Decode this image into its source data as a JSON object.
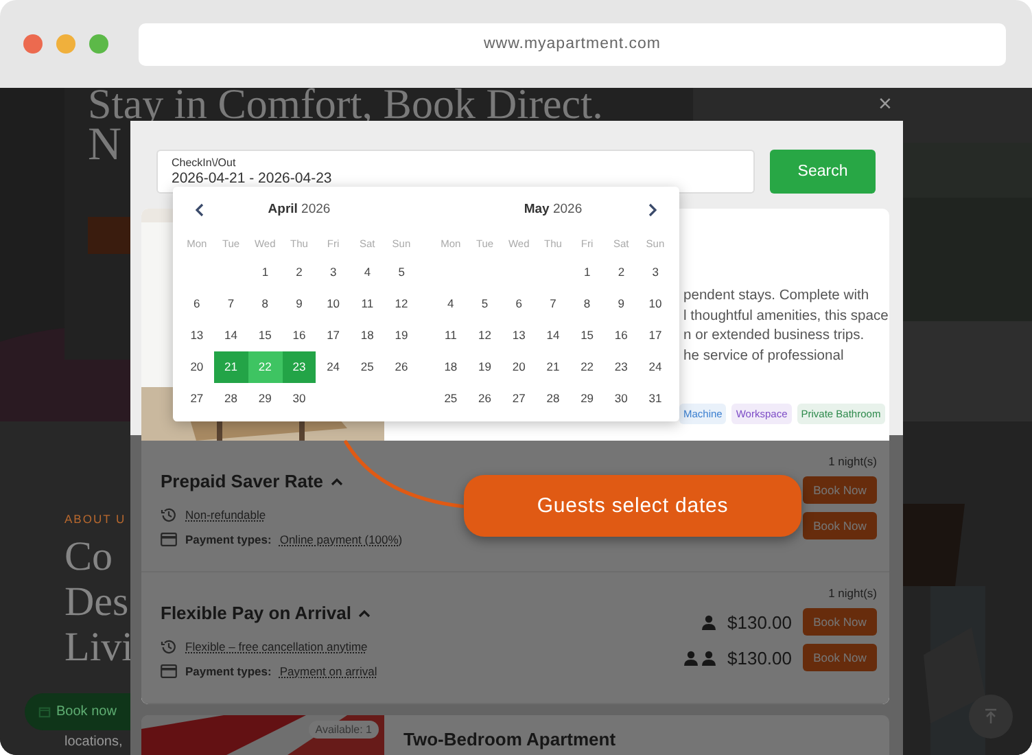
{
  "browser": {
    "url": "www.myapartment.com"
  },
  "background_page": {
    "hero_title": "Stay in Comfort, Book Direct.",
    "hero_title_line_2": "N",
    "about_eyebrow": "ABOUT U",
    "about_heading": [
      "Co",
      "Des",
      "Livi"
    ],
    "book_button": "Book now",
    "body_text": "locations,"
  },
  "modal": {
    "close": "×",
    "date_field": {
      "label": "CheckIn\\/Out",
      "value": "2026-04-21 - 2026-04-23"
    },
    "search_button": "Search",
    "calendar": {
      "months": [
        {
          "month": "April",
          "year": "2026",
          "weekdays": [
            "Mon",
            "Tue",
            "Wed",
            "Thu",
            "Fri",
            "Sat",
            "Sun"
          ],
          "weeks": [
            [
              {
                "day": "1",
                "selected": false,
                "in_range": false
              },
              {
                "day": "2",
                "selected": false,
                "in_range": false
              },
              {
                "day": "3",
                "selected": false,
                "in_range": false
              },
              {
                "day": "4",
                "selected": false,
                "in_range": false
              },
              {
                "day": "5",
                "selected": false,
                "in_range": false
              }
            ],
            [
              {
                "day": "6",
                "selected": false,
                "in_range": false
              },
              {
                "day": "7",
                "selected": false,
                "in_range": false
              },
              {
                "day": "8",
                "selected": false,
                "in_range": false
              },
              {
                "day": "9",
                "selected": false,
                "in_range": false
              },
              {
                "day": "10",
                "selected": false,
                "in_range": false
              },
              {
                "day": "11",
                "selected": false,
                "in_range": false
              },
              {
                "day": "12",
                "selected": false,
                "in_range": false
              }
            ],
            [
              {
                "day": "13",
                "selected": false,
                "in_range": false
              },
              {
                "day": "14",
                "selected": false,
                "in_range": false
              },
              {
                "day": "15",
                "selected": false,
                "in_range": false
              },
              {
                "day": "16",
                "selected": false,
                "in_range": false
              },
              {
                "day": "17",
                "selected": false,
                "in_range": false
              },
              {
                "day": "18",
                "selected": false,
                "in_range": false
              },
              {
                "day": "19",
                "selected": false,
                "in_range": false
              }
            ],
            [
              {
                "day": "20",
                "selected": false,
                "in_range": false
              },
              {
                "day": "21",
                "selected": true,
                "in_range": false
              },
              {
                "day": "22",
                "selected": false,
                "in_range": true
              },
              {
                "day": "23",
                "selected": true,
                "in_range": false
              },
              {
                "day": "24",
                "selected": false,
                "in_range": false
              },
              {
                "day": "25",
                "selected": false,
                "in_range": false
              },
              {
                "day": "26",
                "selected": false,
                "in_range": false
              }
            ],
            [
              {
                "day": "27",
                "selected": false,
                "in_range": false
              },
              {
                "day": "28",
                "selected": false,
                "in_range": false
              },
              {
                "day": "29",
                "selected": false,
                "in_range": false
              },
              {
                "day": "30",
                "selected": false,
                "in_range": false
              }
            ]
          ]
        },
        {
          "month": "May",
          "year": "2026",
          "weekdays": [
            "Mon",
            "Tue",
            "Wed",
            "Thu",
            "Fri",
            "Sat",
            "Sun"
          ],
          "weeks": [
            [
              {
                "day": "1",
                "selected": false,
                "in_range": false
              },
              {
                "day": "2",
                "selected": false,
                "in_range": false
              },
              {
                "day": "3",
                "selected": false,
                "in_range": false
              }
            ],
            [
              {
                "day": "4",
                "selected": false,
                "in_range": false
              },
              {
                "day": "5",
                "selected": false,
                "in_range": false
              },
              {
                "day": "6",
                "selected": false,
                "in_range": false
              },
              {
                "day": "7",
                "selected": false,
                "in_range": false
              },
              {
                "day": "8",
                "selected": false,
                "in_range": false
              },
              {
                "day": "9",
                "selected": false,
                "in_range": false
              },
              {
                "day": "10",
                "selected": false,
                "in_range": false
              }
            ],
            [
              {
                "day": "11",
                "selected": false,
                "in_range": false
              },
              {
                "day": "12",
                "selected": false,
                "in_range": false
              },
              {
                "day": "13",
                "selected": false,
                "in_range": false
              },
              {
                "day": "14",
                "selected": false,
                "in_range": false
              },
              {
                "day": "15",
                "selected": false,
                "in_range": false
              },
              {
                "day": "16",
                "selected": false,
                "in_range": false
              },
              {
                "day": "17",
                "selected": false,
                "in_range": false
              }
            ],
            [
              {
                "day": "18",
                "selected": false,
                "in_range": false
              },
              {
                "day": "19",
                "selected": false,
                "in_range": false
              },
              {
                "day": "20",
                "selected": false,
                "in_range": false
              },
              {
                "day": "21",
                "selected": false,
                "in_range": false
              },
              {
                "day": "22",
                "selected": false,
                "in_range": false
              },
              {
                "day": "23",
                "selected": false,
                "in_range": false
              },
              {
                "day": "24",
                "selected": false,
                "in_range": false
              }
            ],
            [
              {
                "day": "25",
                "selected": false,
                "in_range": false
              },
              {
                "day": "26",
                "selected": false,
                "in_range": false
              },
              {
                "day": "27",
                "selected": false,
                "in_range": false
              },
              {
                "day": "28",
                "selected": false,
                "in_range": false
              },
              {
                "day": "29",
                "selected": false,
                "in_range": false
              },
              {
                "day": "30",
                "selected": false,
                "in_range": false
              },
              {
                "day": "31",
                "selected": false,
                "in_range": false
              }
            ]
          ]
        }
      ]
    },
    "room": {
      "description_lines": [
        "pendent stays. Complete with",
        "l thoughtful amenities, this space",
        "n or extended business trips.",
        "he service of professional"
      ],
      "amenities": [
        {
          "label": "Machine",
          "color": "#3b7fd0"
        },
        {
          "label": "Workspace",
          "color": "#7d4cc6"
        },
        {
          "label": "Private Bathroom",
          "color": "#2e8a4c"
        }
      ],
      "rates": [
        {
          "name": "Prepaid Saver Rate",
          "expanded": true,
          "policy": "Non-refundable",
          "payment_label": "Payment types:",
          "payment_value": "Online payment (100%)",
          "nights": "1 night(s)",
          "prices": [
            {
              "button": "Book Now"
            },
            {
              "button": "Book Now"
            }
          ]
        },
        {
          "name": "Flexible Pay on Arrival",
          "expanded": true,
          "policy": "Flexible – free cancellation anytime",
          "payment_label": "Payment types:",
          "payment_value": "Payment on arrival",
          "nights": "1 night(s)",
          "prices": [
            {
              "kind": "one_guest",
              "price": "$130.00",
              "button": "Book Now"
            },
            {
              "kind": "two_guests",
              "price": "$130.00",
              "button": "Book Now"
            }
          ]
        }
      ]
    },
    "next_room": {
      "badge": "Available: 1",
      "title": "Two-Bedroom Apartment"
    }
  },
  "callout": {
    "text": "Guests select dates"
  }
}
